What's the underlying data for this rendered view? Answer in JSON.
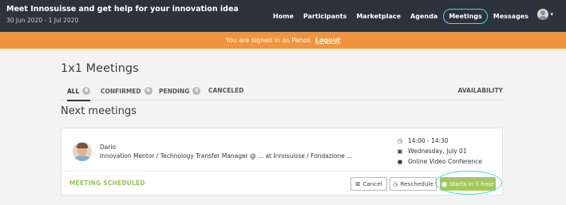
{
  "header": {
    "event_title": "Meet Innosuisse and get help for your innovation idea",
    "event_dates": "30 Jun 2020 - 1 Jul 2020",
    "nav": [
      "Home",
      "Participants",
      "Marketplace",
      "Agenda",
      "Meetings",
      "Messages"
    ],
    "active_nav": "Meetings",
    "avatar_icon": "user-avatar-icon",
    "menu_icon": "chevron-down-icon"
  },
  "banner": {
    "signed_in_text": "You are signed in as Panos",
    "logout_label": "Logout",
    "color": "#f0953f"
  },
  "page": {
    "title": "1x1 Meetings",
    "tabs": [
      {
        "label": "ALL",
        "count": "6"
      },
      {
        "label": "CONFIRMED",
        "count": "6"
      },
      {
        "label": "PENDING",
        "count": "0"
      },
      {
        "label": "CANCELED",
        "count": ""
      }
    ],
    "active_tab": "ALL",
    "availability_label": "AVAILABILITY",
    "section_title": "Next meetings"
  },
  "meeting": {
    "name": "Dario",
    "role": "Innovation Mentor / Technology Transfer Manager @ ... at Innosuisse / Fondazione ...",
    "time": "14:00 - 14:30",
    "date": "Wednesday, July 01",
    "location": "Online Video Conference",
    "status": "MEETING SCHEDULED",
    "cancel_label": "Cancel",
    "reschedule_label": "Reschedule",
    "start_label": "Starts in 1 hour",
    "accent_color": "#a3c860"
  }
}
